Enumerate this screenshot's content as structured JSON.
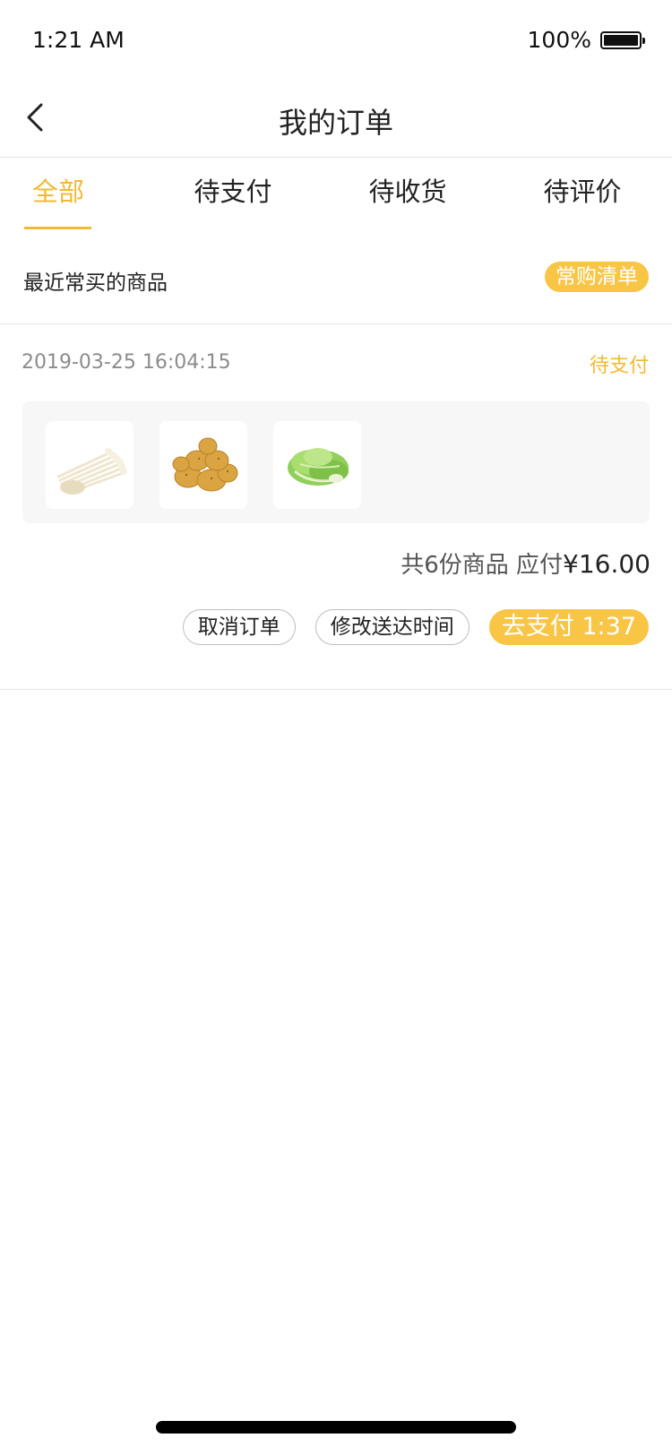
{
  "status_bar": {
    "time": "1:21 AM",
    "battery": "100%"
  },
  "nav": {
    "title": "我的订单",
    "back_icon": "chevron-left-icon"
  },
  "tabs": [
    {
      "label": "全部",
      "active": true
    },
    {
      "label": "待支付",
      "active": false
    },
    {
      "label": "待收货",
      "active": false
    },
    {
      "label": "待评价",
      "active": false
    }
  ],
  "frequent": {
    "label": "最近常买的商品",
    "button_label": "常购清单"
  },
  "order": {
    "datetime": "2019-03-25 16:04:15",
    "status": "待支付",
    "items": [
      {
        "icon": "enoki-mushroom-image"
      },
      {
        "icon": "potato-image"
      },
      {
        "icon": "lettuce-image"
      }
    ],
    "summary_prefix": "共6份商品 应付",
    "amount": "¥16.00",
    "actions": {
      "cancel_label": "取消订单",
      "change_time_label": "修改送达时间",
      "pay_label": "去支付 1:37"
    }
  },
  "colors": {
    "accent": "#f2b934",
    "accent_button": "#f8c545",
    "divider": "#e6e6e6"
  }
}
